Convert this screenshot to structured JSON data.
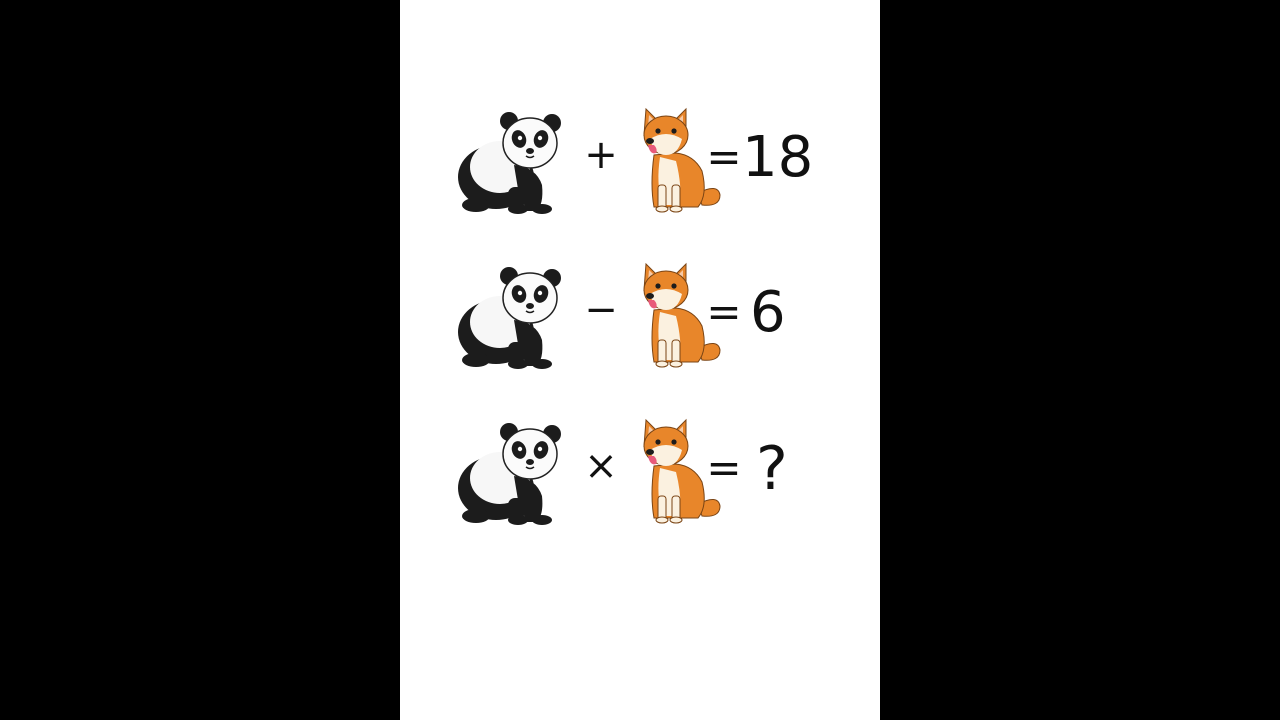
{
  "equations": [
    {
      "operator": "+",
      "equals": "=",
      "result": "18"
    },
    {
      "operator": "−",
      "equals": "=",
      "result": "6"
    },
    {
      "operator": "×",
      "equals": "=",
      "result": "?"
    }
  ],
  "colors": {
    "background": "#000000",
    "panel": "#ffffff",
    "panda_black": "#1c1c1c",
    "dog_orange": "#e8862a",
    "dog_cream": "#fbf1e0"
  },
  "icons": [
    "panda-icon",
    "dog-icon"
  ]
}
